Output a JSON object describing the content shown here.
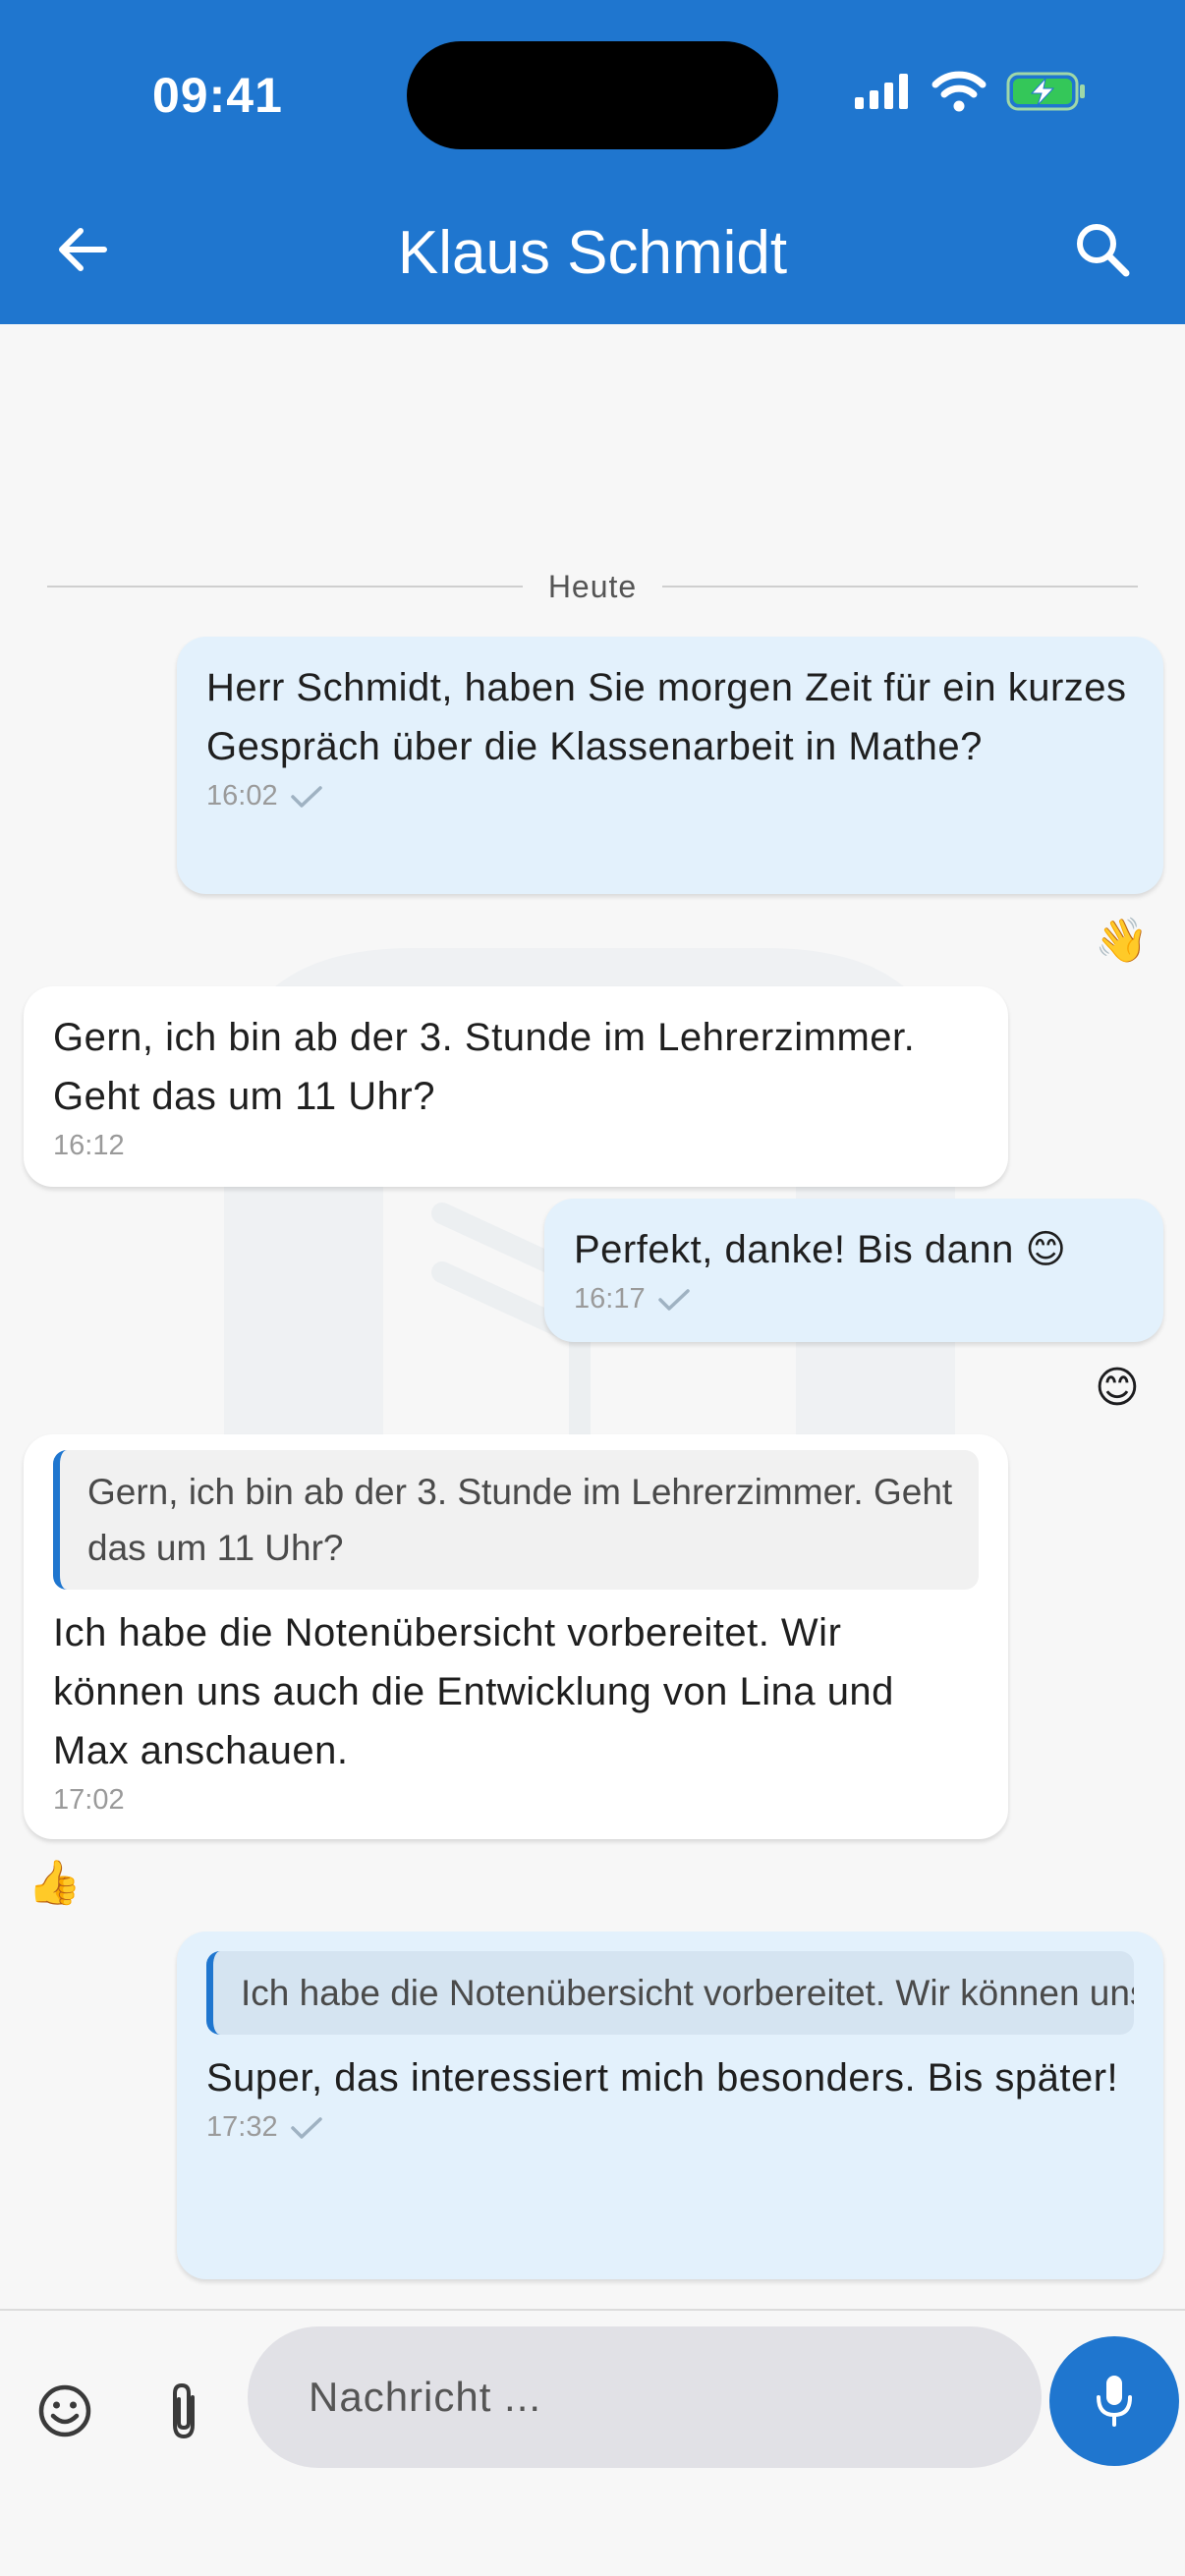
{
  "status_bar": {
    "time": "09:41"
  },
  "header": {
    "title": "Klaus Schmidt"
  },
  "chat": {
    "date_separator": "Heute",
    "messages": [
      {
        "direction": "out",
        "text": "Herr Schmidt, haben Sie morgen Zeit für ein kurzes Gespräch über die Klassenarbeit in Mathe?",
        "time": "16:02",
        "read": true,
        "reaction": "👋"
      },
      {
        "direction": "in",
        "text": "Gern, ich bin ab der 3. Stunde im Lehrerzimmer. Geht das um 11 Uhr?",
        "time": "16:12"
      },
      {
        "direction": "out",
        "text": "Perfekt, danke! Bis dann 😊",
        "time": "16:17",
        "read": true,
        "reaction": "😊"
      },
      {
        "direction": "in",
        "quote": "Gern, ich bin ab der 3. Stunde im Lehrerzimmer. Geht das um 11 Uhr?",
        "text": "Ich habe die Notenübersicht vorbereitet. Wir können uns auch die Entwicklung von Lina und Max anschauen.",
        "time": "17:02",
        "reaction": "👍"
      },
      {
        "direction": "out",
        "quote": "Ich habe die Notenübersicht vorbereitet. Wir können uns auch die Entwicklung von Lina u...",
        "text": "Super, das interessiert mich besonders. Bis später!",
        "time": "17:32",
        "read": true
      }
    ]
  },
  "composer": {
    "placeholder": "Nachricht ..."
  },
  "colors": {
    "primary": "#1f76cf",
    "outgoing_bubble": "#e3f1fc",
    "incoming_bubble": "#ffffff",
    "battery": "#34c759"
  },
  "icons": [
    "back-arrow-icon",
    "search-icon",
    "signal-icon",
    "wifi-icon",
    "battery-charging-icon",
    "checkmark-icon",
    "smiley-icon",
    "paperclip-icon",
    "microphone-icon"
  ]
}
